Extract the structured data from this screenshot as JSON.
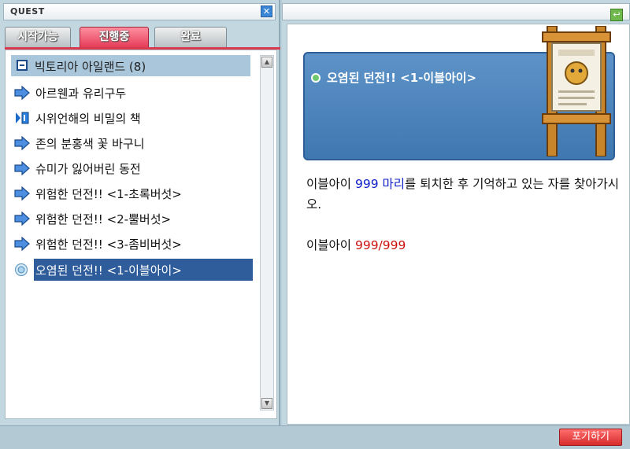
{
  "window": {
    "title": "QUEST"
  },
  "tabs": [
    {
      "label": "시작가능",
      "active": false
    },
    {
      "label": "진행중",
      "active": true
    },
    {
      "label": "완료",
      "active": false
    }
  ],
  "group": {
    "label": "빅토리아 아일랜드 (8)"
  },
  "quests": [
    {
      "label": "아르웬과 유리구두",
      "icon": "arrow-icon"
    },
    {
      "label": "시위언해의 비밀의 책",
      "icon": "flag-icon"
    },
    {
      "label": "존의 분홍색 꽃 바구니",
      "icon": "arrow-icon"
    },
    {
      "label": "슈미가 잃어버린 동전",
      "icon": "arrow-icon"
    },
    {
      "label": "위험한 던전!! <1-초록버섯>",
      "icon": "arrow-icon"
    },
    {
      "label": "위험한 던전!! <2-뿔버섯>",
      "icon": "arrow-icon"
    },
    {
      "label": "위험한 던전!! <3-좀비버섯>",
      "icon": "arrow-icon"
    },
    {
      "label": "오염된 던전!! <1-이블아이>",
      "icon": "target-icon",
      "selected": true
    }
  ],
  "detail": {
    "title": "오염된 던전!! <1-이블아이>",
    "desc_pre": "이블아이 ",
    "desc_highlight": "999 마리",
    "desc_post": "를 퇴치한 후 기억하고 있는 자를 찾아가시오.",
    "progress_label": "이블아이 ",
    "progress_value": "999/999"
  },
  "buttons": {
    "give_up": "포기하기",
    "close": "✕",
    "back": "↩"
  },
  "colors": {
    "accent_blue": "#2f5c9b",
    "tab_active": "#e63d58",
    "highlight_blue": "#1020c8",
    "highlight_red": "#cc1010"
  }
}
